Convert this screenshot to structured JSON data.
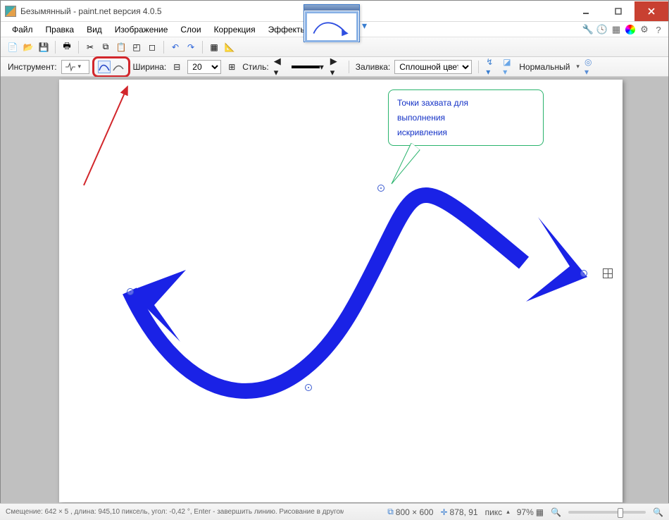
{
  "window": {
    "title": "Безымянный - paint.net версия 4.0.5"
  },
  "menu": {
    "items": [
      "Файл",
      "Правка",
      "Вид",
      "Изображение",
      "Слои",
      "Коррекция",
      "Эффекты"
    ]
  },
  "tool_options": {
    "instrument_label": "Инструмент:",
    "width_label": "Ширина:",
    "width_value": "20",
    "style_label": "Стиль:",
    "fill_label": "Заливка:",
    "fill_value": "Сплошной цвет",
    "blend_label": "Нормальный"
  },
  "annotation": {
    "callout_text": "Точки захвата для\nвыполнения\nискривления"
  },
  "status": {
    "hint": "Смещение: 642 × 5 , длина: 945,10 пиксель, угол: -0,42 °, Enter - завершить линию. Рисование в другом месте создаст новую.",
    "doc_size": "800 × 600",
    "cursor": "878, 91",
    "units": "пикс",
    "zoom": "97%"
  },
  "colors": {
    "curve": "#1a22e6",
    "callout_border": "#29b36c",
    "highlight": "#d2262b"
  }
}
